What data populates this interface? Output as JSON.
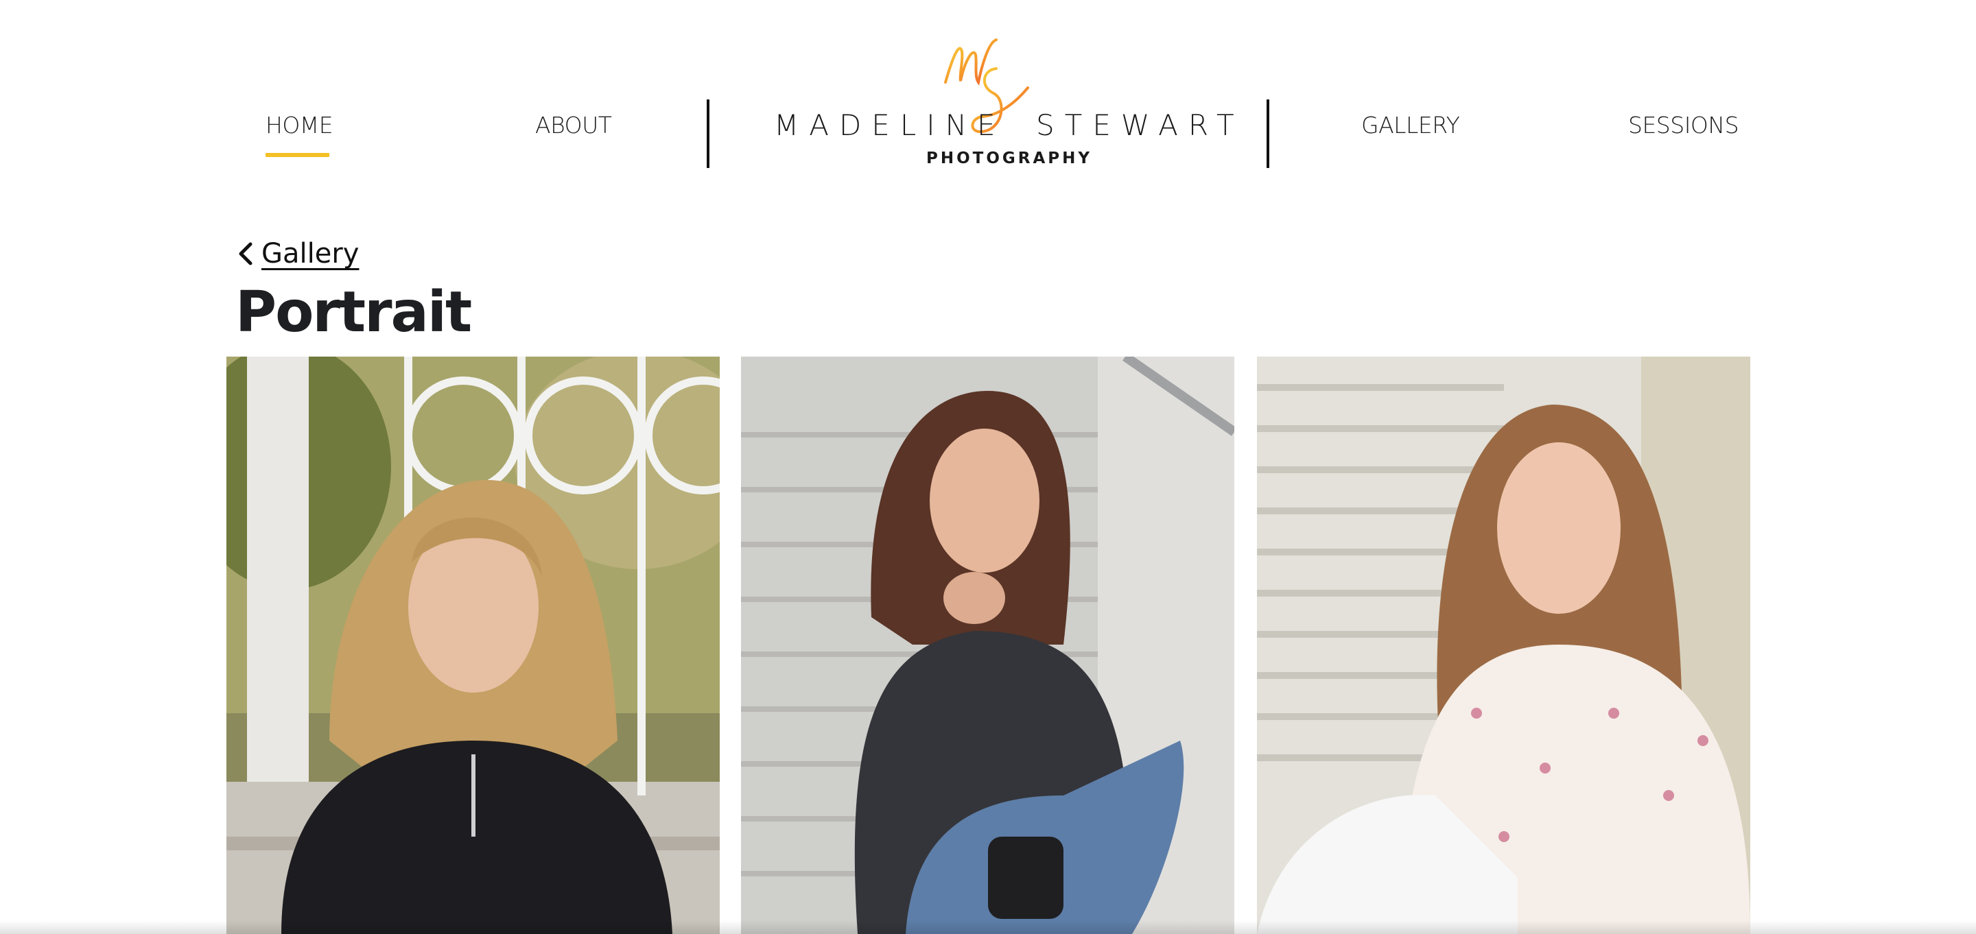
{
  "header": {
    "nav_left": [
      {
        "label": "HOME",
        "active": true
      },
      {
        "label": "ABOUT",
        "active": false
      }
    ],
    "nav_right": [
      {
        "label": "GALLERY",
        "active": false
      },
      {
        "label": "SESSIONS",
        "active": false
      }
    ],
    "logo": {
      "first_name": "MADELINE",
      "last_name": "STEWART",
      "subtitle": "PHOTOGRAPHY",
      "monogram": "MS"
    },
    "accent_color": "#f5c025"
  },
  "breadcrumb": {
    "back_label": "Gallery",
    "icon": "chevron-left-icon"
  },
  "page": {
    "title": "Portrait"
  },
  "gallery": {
    "photos": [
      {
        "subject": "blonde woman in black sweater seated on steps by white gate"
      },
      {
        "subject": "brunette woman in denim jacket and ripped jeans seated on stone stairs"
      },
      {
        "subject": "woman with long hair in floral blouse and white pants seated on wooden stairs"
      }
    ]
  }
}
